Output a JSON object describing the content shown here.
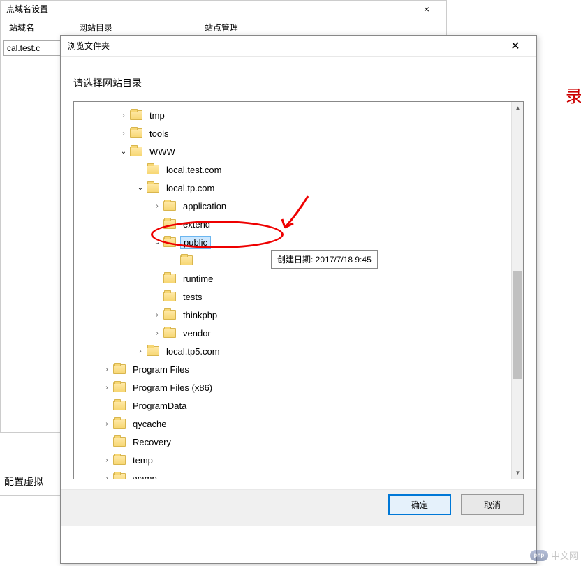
{
  "bg_window": {
    "title": "点域名设置",
    "col_domain": "站域名",
    "col_dir": "网站目录",
    "col_site": "站点管理",
    "input_domain": "cal.test.c",
    "bottom_label": "配置虚拟"
  },
  "red_fragment": "录",
  "browse_dialog": {
    "title": "浏览文件夹",
    "prompt": "请选择网站目录",
    "tooltip": "创建日期: 2017/7/18 9:45",
    "ok_label": "确定",
    "cancel_label": "取消"
  },
  "tree": [
    {
      "depth": 1,
      "expander": ">",
      "label": "tmp"
    },
    {
      "depth": 1,
      "expander": ">",
      "label": "tools"
    },
    {
      "depth": 1,
      "expander": "v",
      "label": "WWW"
    },
    {
      "depth": 2,
      "expander": "",
      "label": "local.test.com"
    },
    {
      "depth": 2,
      "expander": "v",
      "label": "local.tp.com"
    },
    {
      "depth": 3,
      "expander": ">",
      "label": "application"
    },
    {
      "depth": 3,
      "expander": "",
      "label": "extend"
    },
    {
      "depth": 3,
      "expander": "v",
      "label": "public",
      "selected": true
    },
    {
      "depth": 4,
      "expander": "",
      "label": ""
    },
    {
      "depth": 3,
      "expander": "",
      "label": "runtime"
    },
    {
      "depth": 3,
      "expander": "",
      "label": "tests"
    },
    {
      "depth": 3,
      "expander": ">",
      "label": "thinkphp"
    },
    {
      "depth": 3,
      "expander": ">",
      "label": "vendor"
    },
    {
      "depth": 2,
      "expander": ">",
      "label": "local.tp5.com"
    },
    {
      "depth": 0,
      "expander": ">",
      "label": "Program Files"
    },
    {
      "depth": 0,
      "expander": ">",
      "label": "Program Files (x86)"
    },
    {
      "depth": 0,
      "expander": "",
      "label": "ProgramData"
    },
    {
      "depth": 0,
      "expander": ">",
      "label": "qycache"
    },
    {
      "depth": 0,
      "expander": "",
      "label": "Recovery"
    },
    {
      "depth": 0,
      "expander": ">",
      "label": "temp"
    },
    {
      "depth": 0,
      "expander": ">",
      "label": "wamp"
    }
  ],
  "watermark": {
    "logo": "php",
    "text": "中文网"
  }
}
